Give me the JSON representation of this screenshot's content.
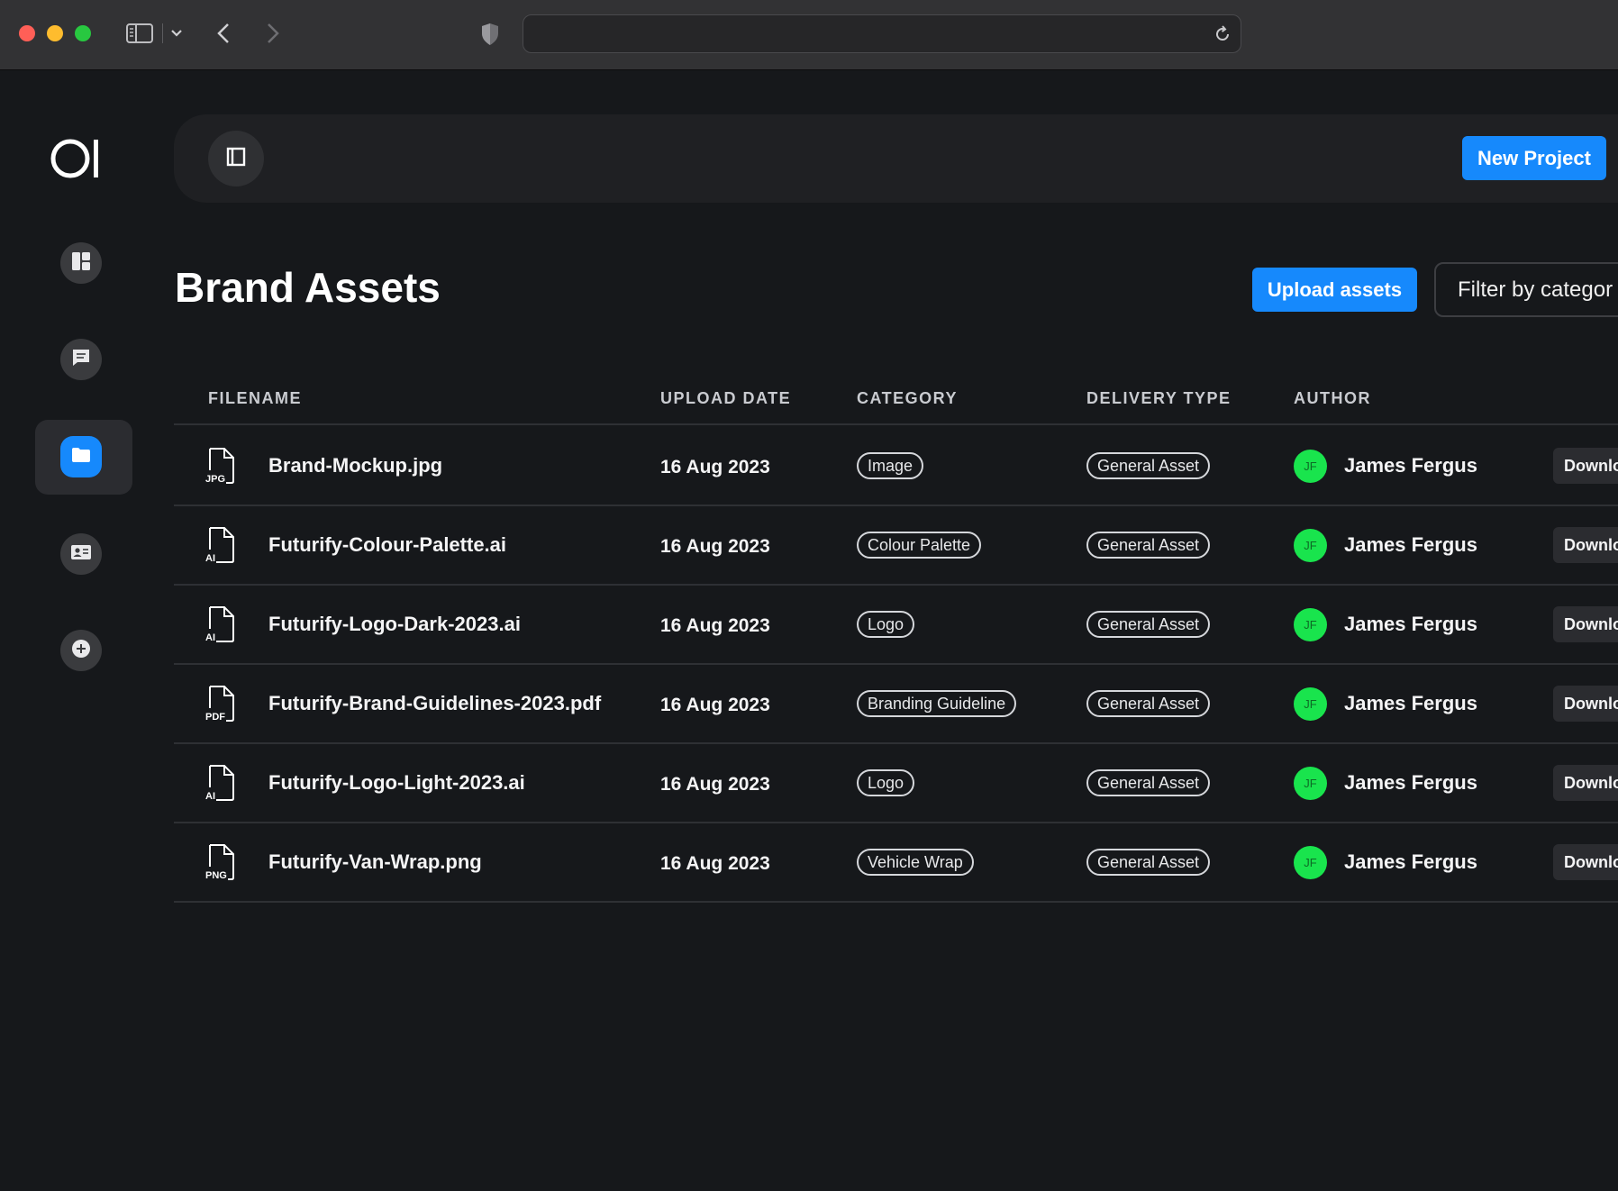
{
  "page": {
    "title": "Brand Assets",
    "new_project_label": "New Project",
    "upload_label": "Upload assets",
    "filter_label": "Filter by categor"
  },
  "sidebar": {
    "logo_text": "OI",
    "items": [
      {
        "icon": "dashboard-icon"
      },
      {
        "icon": "chat-icon"
      },
      {
        "icon": "folder-icon",
        "active": true
      },
      {
        "icon": "contact-card-icon"
      },
      {
        "icon": "add-circle-icon"
      }
    ]
  },
  "table": {
    "headers": [
      "FILENAME",
      "UPLOAD DATE",
      "CATEGORY",
      "DELIVERY TYPE",
      "AUTHOR"
    ],
    "rows": [
      {
        "ext": "JPG",
        "filename": "Brand-Mockup.jpg",
        "date": "16 Aug 2023",
        "category": "Image",
        "delivery": "General Asset",
        "initials": "JF",
        "author": "James Fergus",
        "action": "Downlo"
      },
      {
        "ext": "AI",
        "filename": "Futurify-Colour-Palette.ai",
        "date": "16 Aug 2023",
        "category": "Colour Palette",
        "delivery": "General Asset",
        "initials": "JF",
        "author": "James Fergus",
        "action": "Downlo"
      },
      {
        "ext": "AI",
        "filename": "Futurify-Logo-Dark-2023.ai",
        "date": "16 Aug 2023",
        "category": "Logo",
        "delivery": "General Asset",
        "initials": "JF",
        "author": "James Fergus",
        "action": "Downlo"
      },
      {
        "ext": "PDF",
        "filename": "Futurify-Brand-Guidelines-2023.pdf",
        "date": "16 Aug 2023",
        "category": "Branding Guideline",
        "delivery": "General Asset",
        "initials": "JF",
        "author": "James Fergus",
        "action": "Downlo"
      },
      {
        "ext": "AI",
        "filename": "Futurify-Logo-Light-2023.ai",
        "date": "16 Aug 2023",
        "category": "Logo",
        "delivery": "General Asset",
        "initials": "JF",
        "author": "James Fergus",
        "action": "Downlo"
      },
      {
        "ext": "PNG",
        "filename": "Futurify-Van-Wrap.png",
        "date": "16 Aug 2023",
        "category": "Vehicle Wrap",
        "delivery": "General Asset",
        "initials": "JF",
        "author": "James Fergus",
        "action": "Downlo"
      }
    ]
  },
  "colors": {
    "accent": "#1689fc",
    "avatar": "#19e44d",
    "background": "#16181b"
  }
}
